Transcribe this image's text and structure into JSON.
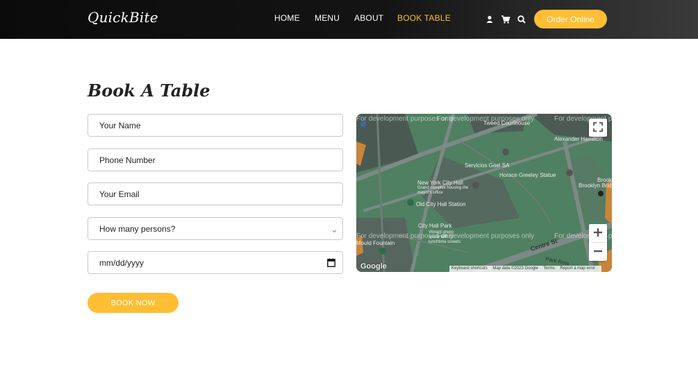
{
  "brand": {
    "name": "QuickBite"
  },
  "nav": {
    "items": [
      {
        "label": "HOME",
        "active": false
      },
      {
        "label": "MENU",
        "active": false
      },
      {
        "label": "ABOUT",
        "active": false
      },
      {
        "label": "BOOK TABLE",
        "active": true
      }
    ],
    "icons": [
      "user-icon",
      "cart-icon",
      "search-icon"
    ],
    "order_button": "Order Online"
  },
  "colors": {
    "accent": "#ffbe33",
    "header_bg": "#0b0b0b",
    "map_green": "#4e7f61"
  },
  "booking": {
    "title": "Book A Table",
    "name_placeholder": "Your Name",
    "phone_placeholder": "Phone Number",
    "email_placeholder": "Your Email",
    "persons_selected": "How many persons?",
    "date_placeholder": "mm/dd/yyyy",
    "submit_label": "BOOK NOW"
  },
  "map": {
    "dev_watermark": "For development purposes only",
    "labels": {
      "court": "Tweed Courthouse",
      "hamilton": "Alexander Hamilton",
      "servicios": "Servicios Gael SA",
      "greeley": "Horace Greeley Statue",
      "bridge": "Brooklyn Bridge City",
      "cityhall": "New York City Hall",
      "cityhall_sub": "Grand complex housing the mayor's office",
      "station": "Old City Hall Station",
      "park": "City Hall Park",
      "park_sub": "Vibrant green space with lunchtime crowds",
      "fountain": "Mould Fountain",
      "centre": "Centre St",
      "park_row": "Park Row",
      "bank": "Bank",
      "brook": "Brook"
    },
    "footer": [
      "Keyboard shortcuts",
      "Map data ©2023 Google",
      "Terms",
      "Report a map error"
    ],
    "logo": "Google",
    "zoom_in": "+",
    "zoom_out": "−"
  }
}
